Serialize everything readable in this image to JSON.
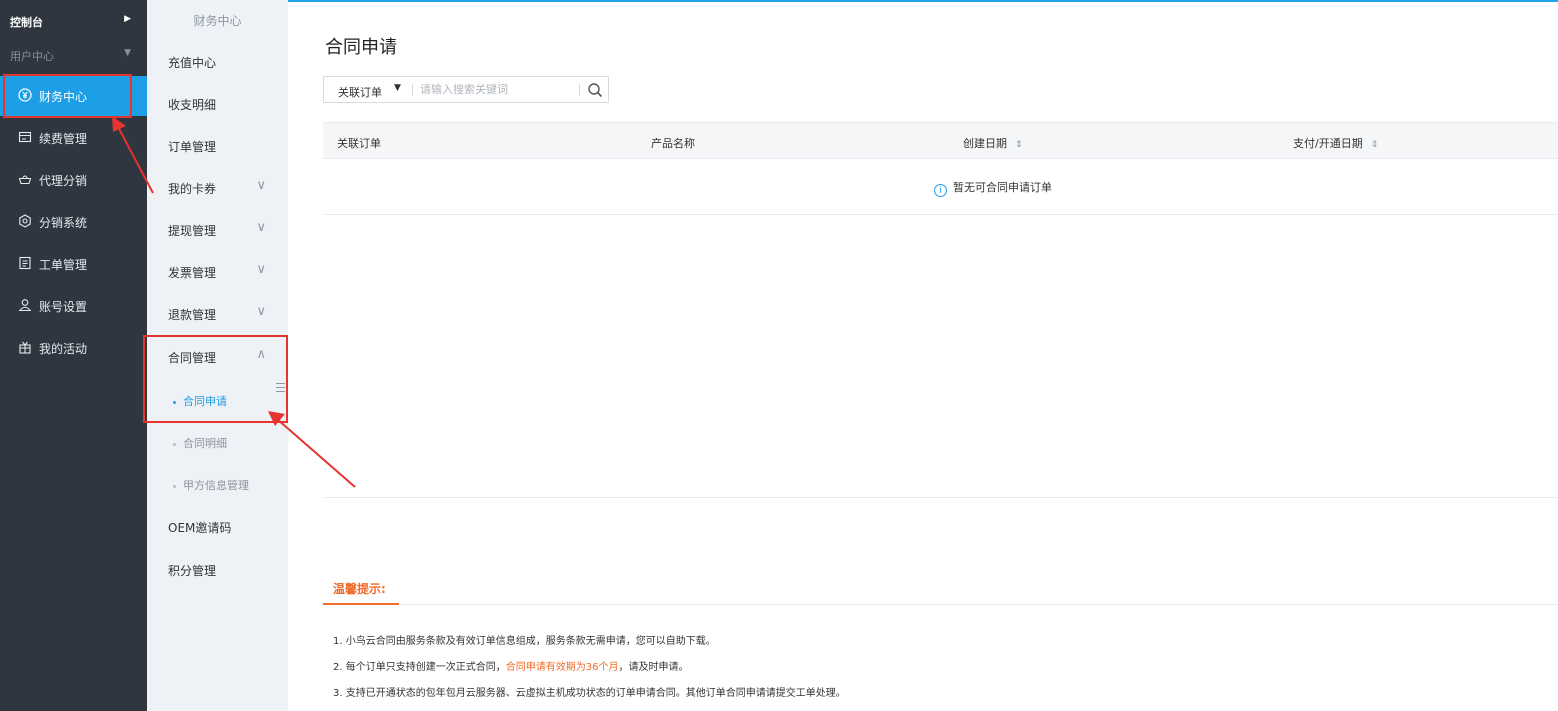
{
  "sidebar": {
    "control_label": "控制台",
    "user_center_label": "用户中心",
    "items": [
      {
        "label": "财务中心",
        "icon": "yuan-circle-icon"
      },
      {
        "label": "续费管理",
        "icon": "card-icon"
      },
      {
        "label": "代理分销",
        "icon": "basket-icon"
      },
      {
        "label": "分销系统",
        "icon": "gear-icon"
      },
      {
        "label": "工单管理",
        "icon": "document-icon"
      },
      {
        "label": "账号设置",
        "icon": "user-icon"
      },
      {
        "label": "我的活动",
        "icon": "gift-icon"
      }
    ],
    "active_color": "#1c9fe6",
    "background": "#2f3640"
  },
  "submenu": {
    "header": "财务中心",
    "items": [
      {
        "label": "充值中心"
      },
      {
        "label": "收支明细"
      },
      {
        "label": "订单管理"
      },
      {
        "label": "我的卡券"
      },
      {
        "label": "提现管理"
      },
      {
        "label": "发票管理"
      },
      {
        "label": "退款管理"
      },
      {
        "label": "合同管理"
      },
      {
        "label": "OEM邀请码"
      },
      {
        "label": "积分管理"
      }
    ],
    "contract_children": [
      {
        "label": "合同申请"
      },
      {
        "label": "合同明细"
      },
      {
        "label": "甲方信息管理"
      }
    ]
  },
  "main": {
    "title": "合同申请",
    "search": {
      "select_value": "关联订单",
      "placeholder": "请输入搜索关键词"
    },
    "table": {
      "columns": [
        "关联订单",
        "产品名称",
        "创建日期",
        "支付/开通日期"
      ],
      "empty_message": "暂无可合同申请订单"
    },
    "tips": {
      "title": "温馨提示:",
      "line1": "1. 小鸟云合同由服务条款及有效订单信息组成，服务条款无需申请，您可以自助下载。",
      "line2_prefix": "2. 每个订单只支持创建一次正式合同，",
      "line2_highlight": "合同申请有效期为36个月",
      "line2_suffix": "，请及时申请。",
      "line3": "3. 支持已开通状态的包年包月云服务器、云虚拟主机成功状态的订单申请合同。其他订单合同申请请提交工单处理。"
    }
  },
  "colors": {
    "accent": "#1c9fe6",
    "highlight": "#f06c2b",
    "annotation": "#e5342e"
  }
}
